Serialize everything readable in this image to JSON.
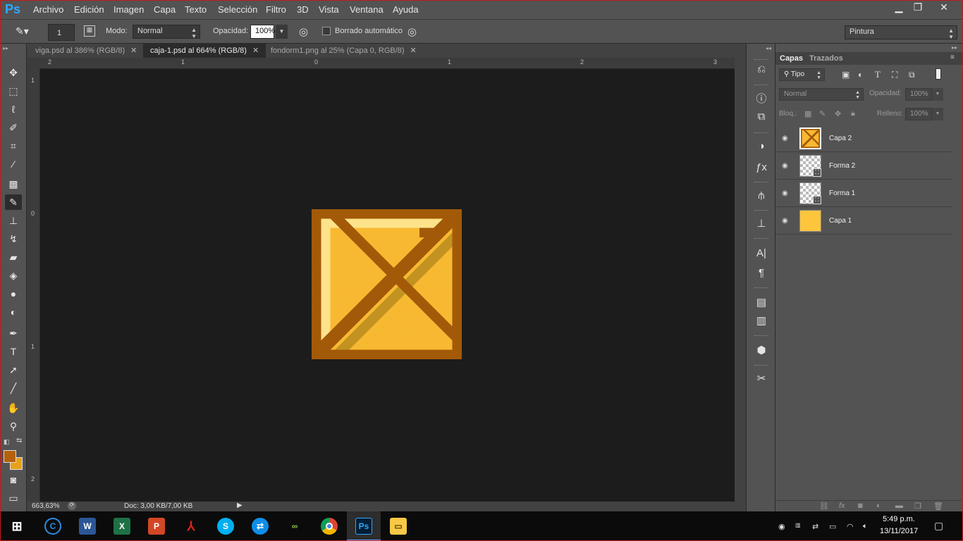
{
  "app": {
    "logo": "Ps",
    "menu": [
      "Archivo",
      "Edición",
      "Imagen",
      "Capa",
      "Texto",
      "Selección",
      "Filtro",
      "3D",
      "Vista",
      "Ventana",
      "Ayuda"
    ],
    "window_controls": [
      "▁",
      "❐",
      "✕"
    ]
  },
  "options": {
    "brush_size": "1",
    "mode_label": "Modo:",
    "mode_value": "Normal",
    "opacity_label": "Opacidad:",
    "opacity_value": "100%",
    "auto_erase_label": "Borrado automático",
    "workspace": "Pintura"
  },
  "tabs": [
    {
      "label": "viga.psd al 386% (RGB/8)"
    },
    {
      "label": "caja-1.psd al 664% (RGB/8)"
    },
    {
      "label": "fondorm1.png al 25% (Capa 0, RGB/8)"
    }
  ],
  "rulers": {
    "top": [
      "2",
      "1",
      "0",
      "1",
      "2",
      "3"
    ],
    "left": [
      "1",
      "0",
      "1",
      "2"
    ]
  },
  "status": {
    "zoom": "663,63%",
    "doc": "Doc: 3,00 KB/7,00 KB"
  },
  "colors": {
    "foreground": "#b4610c",
    "background": "#e8a117",
    "crate_dark": "#a35a08",
    "crate_mid": "#e7a41f",
    "crate_light": "#fcc53b",
    "crate_face": "#f8b932"
  },
  "layers_panel": {
    "tabs": [
      "Capas",
      "Trazados"
    ],
    "filter_label": "Tipo",
    "blend_mode": "Normal",
    "opacity_label": "Opacidad:",
    "opacity_value": "100%",
    "lock_label": "Bloq.:",
    "fill_label": "Relleno:",
    "fill_value": "100%",
    "layers": [
      {
        "name": "Capa 2",
        "thumb": "crate"
      },
      {
        "name": "Forma 2",
        "thumb": "shape"
      },
      {
        "name": "Forma 1",
        "thumb": "shape"
      },
      {
        "name": "Capa 1",
        "thumb": "fill"
      }
    ]
  },
  "taskbar": {
    "time": "5:49 p.m.",
    "date": "13/11/2017"
  }
}
